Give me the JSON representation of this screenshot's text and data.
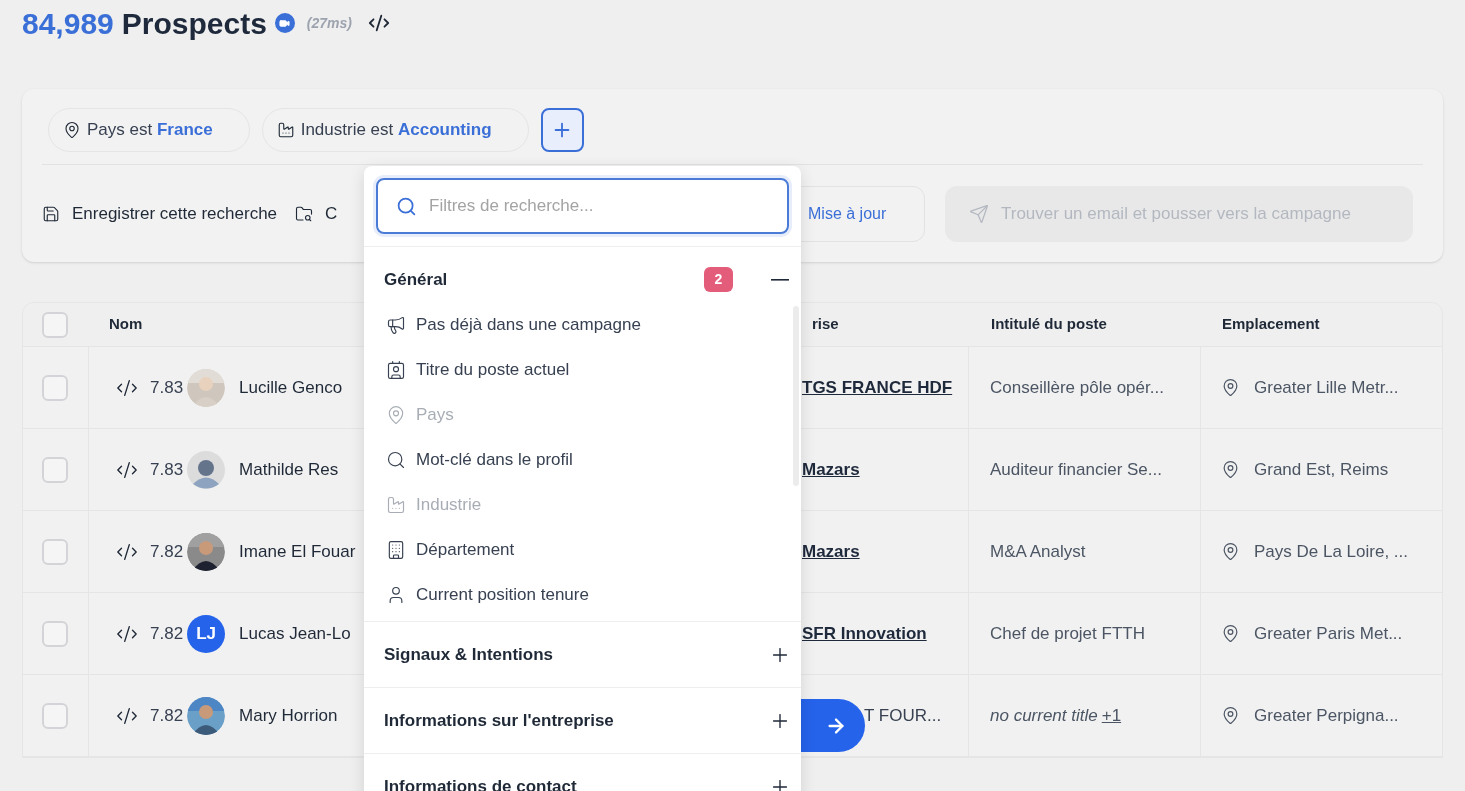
{
  "header": {
    "count": "84,989",
    "title": "Prospects",
    "timing": "(27ms)"
  },
  "filters": [
    {
      "field": "Pays est",
      "value": "France"
    },
    {
      "field": "Industrie est",
      "value": "Accounting"
    }
  ],
  "toolbar": {
    "save_search": "Enregistrer cette recherche",
    "second_action": "C",
    "update_button": "Mise à jour",
    "campaign_button": {
      "label": "Trouver un email et pousser vers la campagne",
      "disabled": true
    }
  },
  "table": {
    "header_checkbox": {
      "checked": false
    },
    "columns": [
      "Nom",
      "rise",
      "Intitulé du poste",
      "Emplacement"
    ],
    "rows": [
      {
        "checked": false,
        "score": "7.83",
        "name": "Lucille Genco",
        "company": "TGS FRANCE HDF",
        "title": "Conseillère pôle opér...",
        "location": "Greater Lille Metr..."
      },
      {
        "checked": false,
        "score": "7.83",
        "avatar": {
          "kind": "silhouette"
        },
        "name": "Mathilde Res",
        "company": "Mazars",
        "title": "Auditeur financier Se...",
        "location": "Grand Est, Reims"
      },
      {
        "checked": false,
        "score": "7.82",
        "name": "Imane El Fouar",
        "company": "Mazars",
        "title": "M&A Analyst",
        "location": "Pays De La Loire, ..."
      },
      {
        "checked": false,
        "score": "7.82",
        "avatar": {
          "kind": "initials",
          "text": "LJ"
        },
        "name": "Lucas Jean-Lo",
        "company": "SFR Innovation",
        "title": "Chef de projet FTTH",
        "location": "Greater Paris Met..."
      },
      {
        "checked": false,
        "score": "7.82",
        "name": "Mary Horrion",
        "company": "T FOUR...",
        "company_link": false,
        "title": "no current title",
        "title_missing": true,
        "title_extra": "+1",
        "location": "Greater Perpigna..."
      }
    ]
  },
  "filter_menu": {
    "search": {
      "placeholder": "Filtres de recherche..."
    },
    "sections": [
      {
        "title": "Général",
        "badge": "2",
        "expanded": true,
        "items": [
          {
            "label": "Pas déjà dans une campagne",
            "disabled": false
          },
          {
            "label": "Titre du poste actuel",
            "disabled": false
          },
          {
            "label": "Pays",
            "disabled": true
          },
          {
            "label": "Mot-clé dans le profil",
            "disabled": false
          },
          {
            "label": "Industrie",
            "disabled": true
          },
          {
            "label": "Département",
            "disabled": false
          },
          {
            "label": "Current position tenure",
            "disabled": false
          }
        ]
      },
      {
        "title": "Signaux & Intentions",
        "expanded": false
      },
      {
        "title": "Informations sur l'entreprise",
        "expanded": false
      },
      {
        "title": "Informations de contact",
        "expanded": false
      }
    ]
  }
}
